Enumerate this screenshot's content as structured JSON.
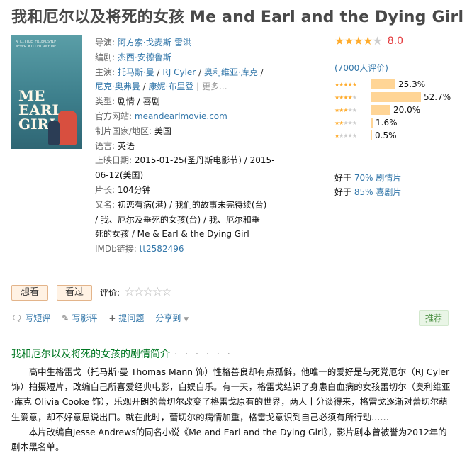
{
  "title": "我和厄尔以及将死的女孩 Me and Earl and the Dying Girl",
  "poster": {
    "tagline": "A LITTLE FRIENDSHIP NEVER KILLED ANYONE.",
    "big_text": "ME EARL GIRL"
  },
  "info": {
    "director_label": "导演:",
    "director": "阿方索·戈麦斯-雷洪",
    "writer_label": "编剧:",
    "writer": "杰西·安德鲁斯",
    "cast_label": "主演:",
    "cast": [
      "托马斯·曼",
      "RJ Cyler",
      "奥利维亚·库克",
      "尼克·奥弗曼",
      "康妮·布里登"
    ],
    "cast_more": "更多...",
    "genre_label": "类型:",
    "genres": [
      "剧情",
      "喜剧"
    ],
    "site_label": "官方网站:",
    "site": "meandearlmovie.com",
    "country_label": "制片国家/地区:",
    "country": "美国",
    "language_label": "语言:",
    "language": "英语",
    "release_label": "上映日期:",
    "release_line1": "2015-01-25(圣丹斯电影节) / 2015-",
    "release_line2": "06-12(美国)",
    "runtime_label": "片长:",
    "runtime": "104分钟",
    "aka_label": "又名:",
    "aka_line1": "初恋有病(港) / 我们的故事未完待续(台)",
    "aka_line2": "/ 我、厄尔及垂死的女孩(台) / 我、厄尔和垂",
    "aka_line3": "死的女孩 / Me & Earl & the Dying Girl",
    "imdb_label": "IMDb链接:",
    "imdb": "tt2582496"
  },
  "rating": {
    "score": "8.0",
    "stars": 4,
    "votes_text": "(7000人评价)",
    "distribution": [
      {
        "stars": 5,
        "percent": 25.3,
        "label": "25.3%"
      },
      {
        "stars": 4,
        "percent": 52.7,
        "label": "52.7%"
      },
      {
        "stars": 3,
        "percent": 20.0,
        "label": "20.0%"
      },
      {
        "stars": 2,
        "percent": 1.6,
        "label": "1.6%"
      },
      {
        "stars": 1,
        "percent": 0.5,
        "label": "0.5%"
      }
    ],
    "better1_prefix": "好于",
    "better1_link": "70% 剧情片",
    "better2_prefix": "好于",
    "better2_link": "85% 喜剧片"
  },
  "buttons": {
    "want": "想看",
    "watched": "看过",
    "rate_label": "评价:"
  },
  "actions": {
    "write_short": "写短评",
    "write_review": "写影评",
    "ask": "提问题",
    "share": "分享到",
    "recommend": "推荐"
  },
  "synopsis": {
    "title": "我和厄尔以及将死的女孩的剧情简介",
    "dots": "· · · · · ·",
    "p1": "高中生格雷戈（托马斯·曼 Thomas Mann 饰）性格善良却有点孤僻，他唯一的爱好是与死党厄尔（RJ Cyler 饰）拍摄短片，改编自己所喜爱经典电影，自娱自乐。有一天，格雷戈结识了身患白血病的女孩蕾切尔（奥利维亚·库克 Olivia Cooke 饰），乐观开朗的蕾切尔改变了格雷戈原有的世界，两人十分谈得来，格雷戈逐渐对蕾切尔萌生爱意，却不好意思说出口。就在此时，蕾切尔的病情加重，格雷戈意识到自己必须有所行动……",
    "p2": "本片改编自Jesse Andrews的同名小说《Me and Earl and the Dying Girl》，影片剧本曾被誉为2012年的剧本黑名单。"
  },
  "colors": {
    "link": "#3377aa",
    "star": "#ffac2d",
    "score": "#e4393c",
    "bar": "#ffd596",
    "synopsis_title": "#007722"
  }
}
